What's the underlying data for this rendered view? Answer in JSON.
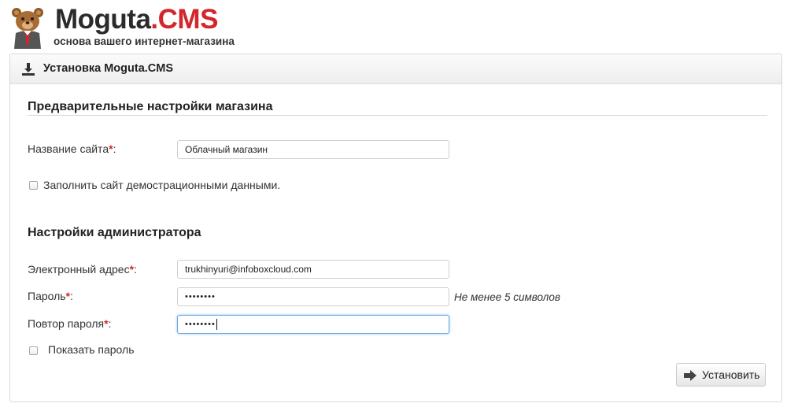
{
  "header": {
    "brand_name": "Moguta",
    "brand_suffix": ".CMS",
    "tagline": "основа вашего интернет-магазина"
  },
  "panel": {
    "title": "Установка Moguta.CMS"
  },
  "store_settings": {
    "title": "Предварительные настройки магазина",
    "site_name_label": "Название сайта",
    "site_name_value": "Облачный магазин",
    "demo_data_label": "Заполнить сайт демострационными данными.",
    "demo_data_checked": false
  },
  "admin_settings": {
    "title": "Настройки администратора",
    "email_label": "Электронный адрес",
    "email_value": "trukhinyuri@infoboxcloud.com",
    "password_label": "Пароль",
    "password_value": "••••••••",
    "password_hint": "Не менее 5 символов",
    "password_repeat_label": "Повтор пароля",
    "password_repeat_value": "••••••••",
    "show_password_label": "Показать пароль",
    "show_password_checked": false
  },
  "required_mark": "*",
  "label_suffix": ":",
  "actions": {
    "install_label": "Установить"
  },
  "colors": {
    "brand_red": "#d4252b",
    "focus_border": "#6ea6de"
  }
}
